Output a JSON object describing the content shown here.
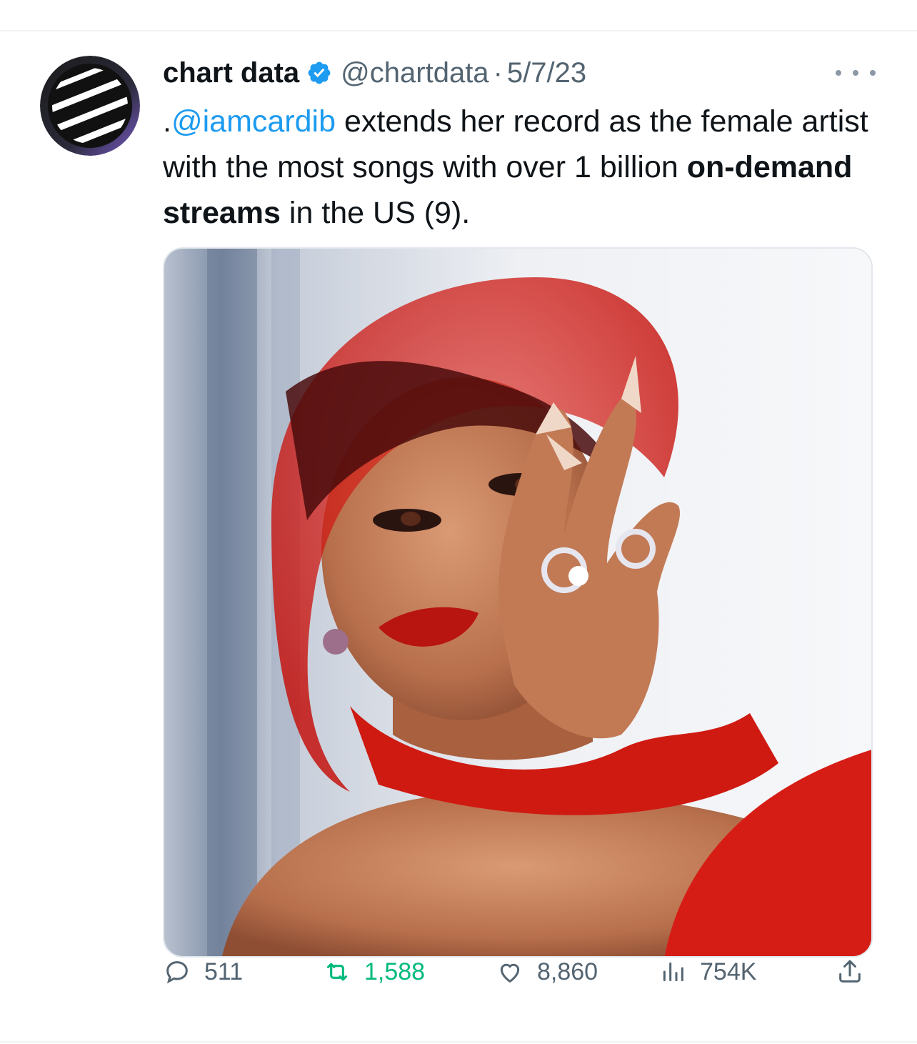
{
  "tweet": {
    "author_name": "chart data",
    "handle": "@chartdata",
    "separator": "·",
    "date": "5/7/23",
    "text_prefix": ".",
    "mention": "@iamcardib",
    "text_part1": " extends her record as the female artist with the most songs with over 1 billion ",
    "text_bold": "on-demand streams",
    "text_part2": " in the US (9)."
  },
  "stats": {
    "replies": "511",
    "retweets": "1,588",
    "likes": "8,860",
    "views": "754K"
  },
  "colors": {
    "accent": "#1d9bf0",
    "retweet_active": "#00ba7c",
    "muted": "#536471",
    "verified": "#1d9bf0"
  },
  "icons": {
    "verified": "verified-badge-icon",
    "more": "more-icon",
    "reply": "reply-icon",
    "retweet": "retweet-icon",
    "like": "heart-icon",
    "views": "views-icon",
    "share": "share-icon"
  }
}
